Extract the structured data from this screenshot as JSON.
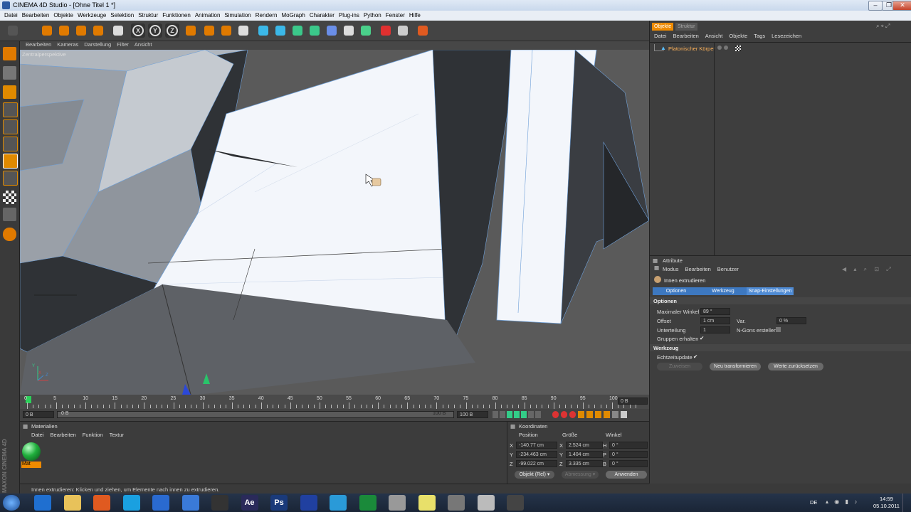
{
  "window": {
    "title": "CINEMA 4D Studio - [Ohne Titel 1 *]"
  },
  "menu": [
    "Datei",
    "Bearbeiten",
    "Objekte",
    "Werkzeuge",
    "Selektion",
    "Struktur",
    "Funktionen",
    "Animation",
    "Simulation",
    "Rendern",
    "MoGraph",
    "Charakter",
    "Plug-ins",
    "Python",
    "Fenster",
    "Hilfe"
  ],
  "toolbar_icons": [
    "undo-icon",
    "redo-icon",
    "live-select-icon",
    "move-icon",
    "scale-icon",
    "rotate-icon",
    "recent-tools-icon",
    "x-axis-icon",
    "y-axis-icon",
    "z-axis-icon",
    "coordinate-system-icon",
    "render-view-icon",
    "render-picture-viewer-icon",
    "render-settings-icon",
    "cube-icon",
    "spline-icon",
    "nurbs-icon",
    "array-icon",
    "deformer-icon",
    "scene-icon",
    "mograph-icon",
    "help-icon",
    "layout-icon",
    "web-icon"
  ],
  "axis_labels": {
    "x": "X",
    "y": "Y",
    "z": "Z"
  },
  "viewport": {
    "menu": [
      "Bearbeiten",
      "Kameras",
      "Darstellung",
      "Filter",
      "Ansicht"
    ],
    "camera_label": "Zentralperspektive"
  },
  "timeline": {
    "ticks": [
      "0",
      "5",
      "10",
      "15",
      "20",
      "25",
      "30",
      "35",
      "40",
      "45",
      "50",
      "55",
      "60",
      "65",
      "70",
      "75",
      "80",
      "85",
      "90",
      "95",
      "100"
    ],
    "current_frame": "0 B",
    "start": "0 B",
    "min": "0 B",
    "max": "100 B",
    "end": "100 B"
  },
  "object_manager": {
    "tabs": [
      "Objekte",
      "Struktur"
    ],
    "menu": [
      "Datei",
      "Bearbeiten",
      "Ansicht",
      "Objekte",
      "Tags",
      "Lesezeichen"
    ],
    "objects": [
      {
        "name": "Platonischer Körper"
      }
    ]
  },
  "attributes": {
    "title": "Attribute",
    "menu": [
      "Modus",
      "Bearbeiten",
      "Benutzer"
    ],
    "tool_name": "Innen extrudieren",
    "tabs": [
      "Optionen",
      "Werkzeug",
      "Snap-Einstellungen"
    ],
    "section_options": "Optionen",
    "fields": {
      "max_angle_label": "Maximaler Winkel",
      "max_angle": "89 °",
      "offset_label": "Offset",
      "offset": "1 cm",
      "var_label": "Var.",
      "var": "0 %",
      "subdiv_label": "Unterteilung",
      "subdiv": "1",
      "ngons_label": "N-Gons erstellen",
      "groups_label": "Gruppen erhalten",
      "groups_check": "✔"
    },
    "section_tool": "Werkzeug",
    "realtime_label": "Echtzeitupdate",
    "realtime_check": "✔",
    "buttons": {
      "apply": "Zuweisen",
      "new_transform": "Neu transformieren",
      "reset": "Werte zurücksetzen"
    }
  },
  "materials": {
    "title": "Materialien",
    "menu": [
      "Datei",
      "Bearbeiten",
      "Funktion",
      "Textur"
    ],
    "items": [
      {
        "name": "Mat",
        "color": "#1fae3c"
      }
    ]
  },
  "coordinates": {
    "title": "Koordinaten",
    "headers": [
      "Position",
      "Größe",
      "Winkel"
    ],
    "rows": [
      {
        "axis": "X",
        "pos": "-140.77 cm",
        "size_axis": "X",
        "size": "2.524 cm",
        "rot_axis": "H",
        "rot": "0 °"
      },
      {
        "axis": "Y",
        "pos": "-234.463 cm",
        "size_axis": "Y",
        "size": "1.404 cm",
        "rot_axis": "P",
        "rot": "0 °"
      },
      {
        "axis": "Z",
        "pos": "-99.022 cm",
        "size_axis": "Z",
        "size": "3.335 cm",
        "rot_axis": "B",
        "rot": "0 °"
      }
    ],
    "mode": "Objekt (Rel)",
    "size_mode": "Abmessung",
    "apply": "Anwenden"
  },
  "status": "Innen extrudieren: Klicken und ziehen, um Elemente nach innen zu extrudieren.",
  "brand": "MAXON CINEMA 4D",
  "taskbar": {
    "apps": [
      "ie-icon",
      "explorer-icon",
      "media-center-icon",
      "skype-icon",
      "virtualbox-icon",
      "itunes-icon",
      "camera-icon",
      "after-effects-icon",
      "photoshop-icon",
      "cinema4d-icon",
      "globe-icon",
      "excel-icon",
      "tool-icon",
      "notes-icon",
      "network-icon",
      "doc-icon",
      "usb-icon"
    ],
    "ae_label": "Ae",
    "ps_label": "Ps",
    "lang": "DE",
    "time": "14:59",
    "date": "05.10.2011"
  },
  "colors": {
    "accent": "#ee8a00",
    "mesh_face": "#f3f6fb",
    "mesh_edge": "#6fa0d8",
    "viewport_bg": "#595959"
  }
}
